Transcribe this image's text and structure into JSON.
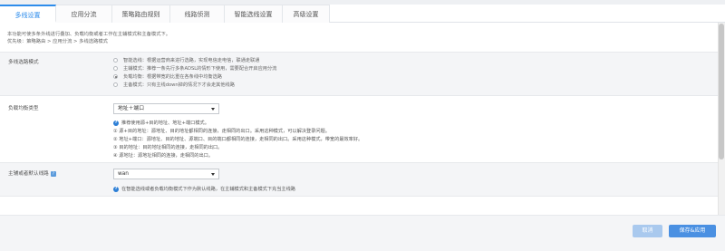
{
  "tabs": [
    {
      "label": "多线设置",
      "active": true
    },
    {
      "label": "应用分流",
      "active": false
    },
    {
      "label": "策略路由规则",
      "active": false
    },
    {
      "label": "线路侦测",
      "active": false
    },
    {
      "label": "智能选线设置",
      "active": false
    },
    {
      "label": "高级设置",
      "active": false
    }
  ],
  "intro": {
    "description": "本功能可使多条外线进行叠加、负载均衡或者工作在主辅模式和主备模式下。",
    "priority": "优先级：策略路由 > 应用分流 > 多线选路模式"
  },
  "route_mode": {
    "label": "多线选路模式",
    "options": [
      {
        "text": "智能选线：根据运营商来进行选路，实现电信走电信，联通走联通",
        "checked": false
      },
      {
        "text": "主辅模式：推荐一条先行多条ADSL的情形下使用，需要配合开启应用分流",
        "checked": false
      },
      {
        "text": "负载均衡：根据带宽的比重在各条线中均衡选路",
        "checked": true
      },
      {
        "text": "主备模式：只有主线down掉的情况下才会走其他线路",
        "checked": false
      }
    ]
  },
  "balance_type": {
    "label": "负载均衡类型",
    "selected": "地址＋端口",
    "hint": "推荐使用源+目的地址、地址+端口模式。",
    "lines": [
      "① 源+目的地址：源地址、目的地址都相同的连接，走相同的出口。采用这种模式，可以解决登录问题。",
      "② 地址+端口：源地址、目的地址、源端口、目的端口都相同的连接，走相同的出口。采用这种模式，带宽的最效率好。",
      "③ 目的地址：目的地址相同的连接，走相同的出口。",
      "④ 源地址：源地址相同的连接，走相同的出口。"
    ]
  },
  "default_line": {
    "label": "主辅或者默认线路",
    "help_icon": "?",
    "selected": "wan",
    "hint": "在智能选线或者负载均衡模式下作为默认线路，在主辅模式和主备模式下充当主线路"
  },
  "footer": {
    "cancel_label": "取消",
    "save_label": "保存&应用",
    "save_color": "#4a90e2",
    "cancel_color": "#a9c9ee"
  }
}
